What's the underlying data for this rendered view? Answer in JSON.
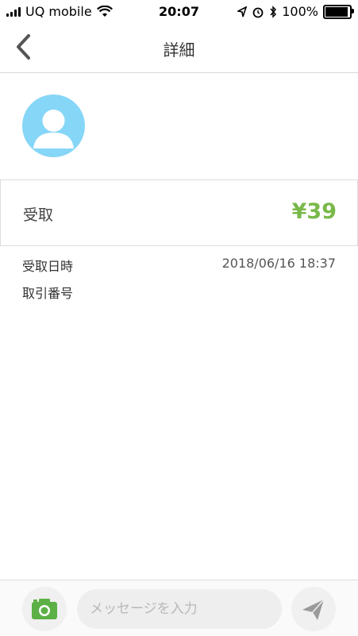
{
  "status_bar": {
    "carrier": "UQ mobile",
    "time": "20:07",
    "battery": "100%"
  },
  "nav": {
    "title": "詳細"
  },
  "transaction": {
    "type_label": "受取",
    "amount": "¥39",
    "amount_color": "#79b84a",
    "details": [
      {
        "key": "受取日時",
        "value": "2018/06/16 18:37"
      },
      {
        "key": "取引番号",
        "value": ""
      }
    ]
  },
  "composer": {
    "placeholder": "メッセージを入力",
    "camera_icon_color": "#5cb046"
  },
  "icons": {
    "back": "chevron-left-icon",
    "avatar": "user-icon",
    "camera": "camera-icon",
    "send": "send-icon"
  }
}
